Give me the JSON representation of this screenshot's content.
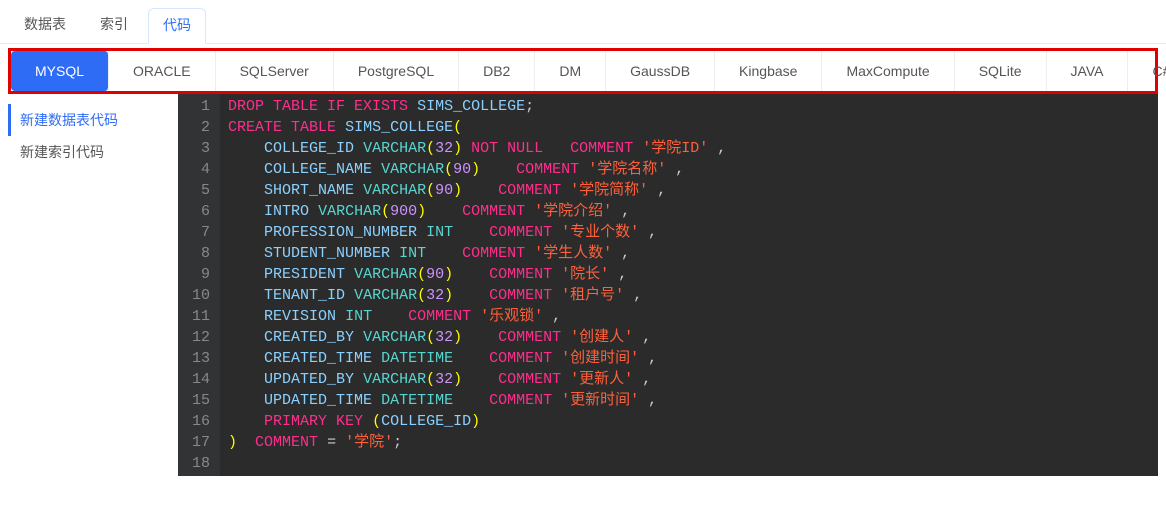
{
  "topTabs": [
    {
      "label": "数据表",
      "active": false
    },
    {
      "label": "索引",
      "active": false
    },
    {
      "label": "代码",
      "active": true
    }
  ],
  "dbTabs": [
    {
      "label": "MYSQL",
      "active": true
    },
    {
      "label": "ORACLE",
      "active": false
    },
    {
      "label": "SQLServer",
      "active": false
    },
    {
      "label": "PostgreSQL",
      "active": false
    },
    {
      "label": "DB2",
      "active": false
    },
    {
      "label": "DM",
      "active": false
    },
    {
      "label": "GaussDB",
      "active": false
    },
    {
      "label": "Kingbase",
      "active": false
    },
    {
      "label": "MaxCompute",
      "active": false
    },
    {
      "label": "SQLite",
      "active": false
    },
    {
      "label": "JAVA",
      "active": false
    },
    {
      "label": "C#",
      "active": false
    }
  ],
  "sideItems": [
    {
      "label": "新建数据表代码",
      "active": true
    },
    {
      "label": "新建索引代码",
      "active": false
    }
  ],
  "code": {
    "lines": [
      [
        [
          "kw",
          "DROP TABLE IF EXISTS"
        ],
        [
          "wh",
          " "
        ],
        [
          "id",
          "SIMS_COLLEGE"
        ],
        [
          "pn",
          ";"
        ]
      ],
      [
        [
          "kw",
          "CREATE TABLE"
        ],
        [
          "wh",
          " "
        ],
        [
          "id",
          "SIMS_COLLEGE"
        ],
        [
          "fn",
          "("
        ]
      ],
      [
        [
          "wh",
          "    "
        ],
        [
          "id",
          "COLLEGE_ID"
        ],
        [
          "wh",
          " "
        ],
        [
          "tp",
          "VARCHAR"
        ],
        [
          "fn",
          "("
        ],
        [
          "nm",
          "32"
        ],
        [
          "fn",
          ")"
        ],
        [
          "wh",
          " "
        ],
        [
          "kw",
          "NOT NULL"
        ],
        [
          "wh",
          "   "
        ],
        [
          "kw",
          "COMMENT"
        ],
        [
          "wh",
          " "
        ],
        [
          "cm",
          "'学院ID'"
        ],
        [
          "wh",
          " "
        ],
        [
          "pn",
          ","
        ]
      ],
      [
        [
          "wh",
          "    "
        ],
        [
          "id",
          "COLLEGE_NAME"
        ],
        [
          "wh",
          " "
        ],
        [
          "tp",
          "VARCHAR"
        ],
        [
          "fn",
          "("
        ],
        [
          "nm",
          "90"
        ],
        [
          "fn",
          ")"
        ],
        [
          "wh",
          "    "
        ],
        [
          "kw",
          "COMMENT"
        ],
        [
          "wh",
          " "
        ],
        [
          "cm",
          "'学院名称'"
        ],
        [
          "wh",
          " "
        ],
        [
          "pn",
          ","
        ]
      ],
      [
        [
          "wh",
          "    "
        ],
        [
          "id",
          "SHORT_NAME"
        ],
        [
          "wh",
          " "
        ],
        [
          "tp",
          "VARCHAR"
        ],
        [
          "fn",
          "("
        ],
        [
          "nm",
          "90"
        ],
        [
          "fn",
          ")"
        ],
        [
          "wh",
          "    "
        ],
        [
          "kw",
          "COMMENT"
        ],
        [
          "wh",
          " "
        ],
        [
          "cm",
          "'学院简称'"
        ],
        [
          "wh",
          " "
        ],
        [
          "pn",
          ","
        ]
      ],
      [
        [
          "wh",
          "    "
        ],
        [
          "id",
          "INTRO"
        ],
        [
          "wh",
          " "
        ],
        [
          "tp",
          "VARCHAR"
        ],
        [
          "fn",
          "("
        ],
        [
          "nm",
          "900"
        ],
        [
          "fn",
          ")"
        ],
        [
          "wh",
          "    "
        ],
        [
          "kw",
          "COMMENT"
        ],
        [
          "wh",
          " "
        ],
        [
          "cm",
          "'学院介绍'"
        ],
        [
          "wh",
          " "
        ],
        [
          "pn",
          ","
        ]
      ],
      [
        [
          "wh",
          "    "
        ],
        [
          "id",
          "PROFESSION_NUMBER"
        ],
        [
          "wh",
          " "
        ],
        [
          "tp",
          "INT"
        ],
        [
          "wh",
          "    "
        ],
        [
          "kw",
          "COMMENT"
        ],
        [
          "wh",
          " "
        ],
        [
          "cm",
          "'专业个数'"
        ],
        [
          "wh",
          " "
        ],
        [
          "pn",
          ","
        ]
      ],
      [
        [
          "wh",
          "    "
        ],
        [
          "id",
          "STUDENT_NUMBER"
        ],
        [
          "wh",
          " "
        ],
        [
          "tp",
          "INT"
        ],
        [
          "wh",
          "    "
        ],
        [
          "kw",
          "COMMENT"
        ],
        [
          "wh",
          " "
        ],
        [
          "cm",
          "'学生人数'"
        ],
        [
          "wh",
          " "
        ],
        [
          "pn",
          ","
        ]
      ],
      [
        [
          "wh",
          "    "
        ],
        [
          "id",
          "PRESIDENT"
        ],
        [
          "wh",
          " "
        ],
        [
          "tp",
          "VARCHAR"
        ],
        [
          "fn",
          "("
        ],
        [
          "nm",
          "90"
        ],
        [
          "fn",
          ")"
        ],
        [
          "wh",
          "    "
        ],
        [
          "kw",
          "COMMENT"
        ],
        [
          "wh",
          " "
        ],
        [
          "cm",
          "'院长'"
        ],
        [
          "wh",
          " "
        ],
        [
          "pn",
          ","
        ]
      ],
      [
        [
          "wh",
          "    "
        ],
        [
          "id",
          "TENANT_ID"
        ],
        [
          "wh",
          " "
        ],
        [
          "tp",
          "VARCHAR"
        ],
        [
          "fn",
          "("
        ],
        [
          "nm",
          "32"
        ],
        [
          "fn",
          ")"
        ],
        [
          "wh",
          "    "
        ],
        [
          "kw",
          "COMMENT"
        ],
        [
          "wh",
          " "
        ],
        [
          "cm",
          "'租户号'"
        ],
        [
          "wh",
          " "
        ],
        [
          "pn",
          ","
        ]
      ],
      [
        [
          "wh",
          "    "
        ],
        [
          "id",
          "REVISION"
        ],
        [
          "wh",
          " "
        ],
        [
          "tp",
          "INT"
        ],
        [
          "wh",
          "    "
        ],
        [
          "kw",
          "COMMENT"
        ],
        [
          "wh",
          " "
        ],
        [
          "cm",
          "'乐观锁'"
        ],
        [
          "wh",
          " "
        ],
        [
          "pn",
          ","
        ]
      ],
      [
        [
          "wh",
          "    "
        ],
        [
          "id",
          "CREATED_BY"
        ],
        [
          "wh",
          " "
        ],
        [
          "tp",
          "VARCHAR"
        ],
        [
          "fn",
          "("
        ],
        [
          "nm",
          "32"
        ],
        [
          "fn",
          ")"
        ],
        [
          "wh",
          "    "
        ],
        [
          "kw",
          "COMMENT"
        ],
        [
          "wh",
          " "
        ],
        [
          "cm",
          "'创建人'"
        ],
        [
          "wh",
          " "
        ],
        [
          "pn",
          ","
        ]
      ],
      [
        [
          "wh",
          "    "
        ],
        [
          "id",
          "CREATED_TIME"
        ],
        [
          "wh",
          " "
        ],
        [
          "tp",
          "DATETIME"
        ],
        [
          "wh",
          "    "
        ],
        [
          "kw",
          "COMMENT"
        ],
        [
          "wh",
          " "
        ],
        [
          "cm",
          "'创建时间'"
        ],
        [
          "wh",
          " "
        ],
        [
          "pn",
          ","
        ]
      ],
      [
        [
          "wh",
          "    "
        ],
        [
          "id",
          "UPDATED_BY"
        ],
        [
          "wh",
          " "
        ],
        [
          "tp",
          "VARCHAR"
        ],
        [
          "fn",
          "("
        ],
        [
          "nm",
          "32"
        ],
        [
          "fn",
          ")"
        ],
        [
          "wh",
          "    "
        ],
        [
          "kw",
          "COMMENT"
        ],
        [
          "wh",
          " "
        ],
        [
          "cm",
          "'更新人'"
        ],
        [
          "wh",
          " "
        ],
        [
          "pn",
          ","
        ]
      ],
      [
        [
          "wh",
          "    "
        ],
        [
          "id",
          "UPDATED_TIME"
        ],
        [
          "wh",
          " "
        ],
        [
          "tp",
          "DATETIME"
        ],
        [
          "wh",
          "    "
        ],
        [
          "kw",
          "COMMENT"
        ],
        [
          "wh",
          " "
        ],
        [
          "cm",
          "'更新时间'"
        ],
        [
          "wh",
          " "
        ],
        [
          "pn",
          ","
        ]
      ],
      [
        [
          "wh",
          "    "
        ],
        [
          "kw",
          "PRIMARY KEY"
        ],
        [
          "wh",
          " "
        ],
        [
          "fn",
          "("
        ],
        [
          "id",
          "COLLEGE_ID"
        ],
        [
          "fn",
          ")"
        ]
      ],
      [
        [
          "fn",
          ")"
        ],
        [
          "wh",
          "  "
        ],
        [
          "kw",
          "COMMENT"
        ],
        [
          "wh",
          " "
        ],
        [
          "pn",
          "="
        ],
        [
          "wh",
          " "
        ],
        [
          "cm",
          "'学院'"
        ],
        [
          "pn",
          ";"
        ]
      ],
      [
        [
          "wh",
          ""
        ]
      ]
    ]
  }
}
